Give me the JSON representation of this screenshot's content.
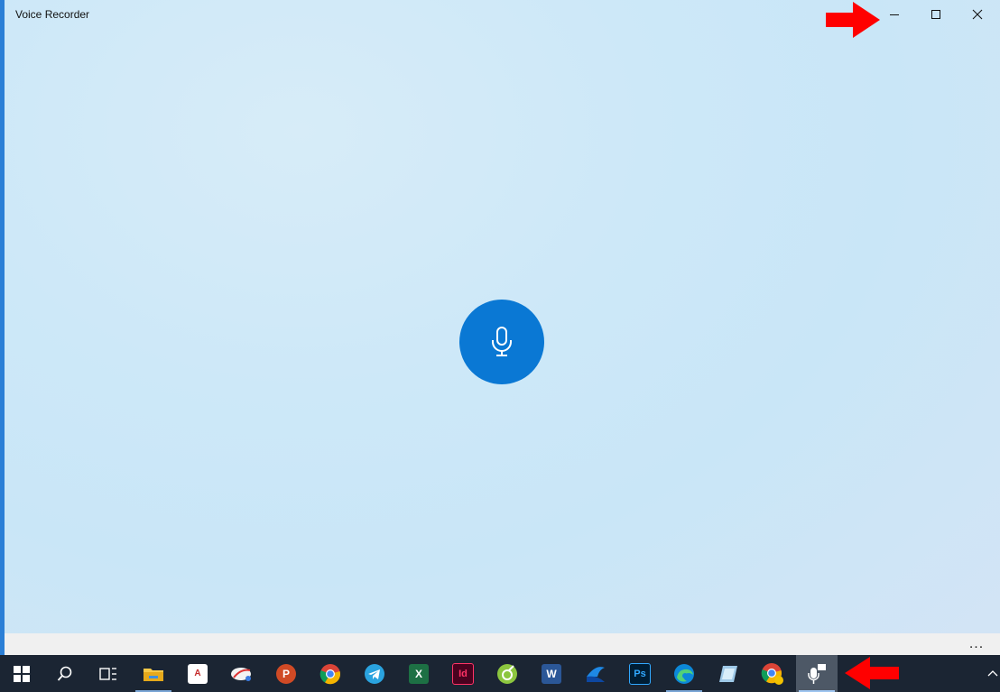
{
  "window": {
    "title": "Voice Recorder"
  },
  "main": {
    "record_button_icon": "microphone-icon"
  },
  "bottom_bar": {
    "more_label": "..."
  },
  "taskbar": {
    "apps": [
      {
        "name": "start",
        "icon": "windows-logo-icon"
      },
      {
        "name": "search",
        "icon": "search-icon"
      },
      {
        "name": "task-view",
        "icon": "task-view-icon"
      },
      {
        "name": "file-explorer",
        "icon": "folder-icon"
      },
      {
        "name": "app-5",
        "icon": "app-icon"
      },
      {
        "name": "app-6",
        "icon": "app-icon"
      },
      {
        "name": "powerpoint",
        "icon": "powerpoint-icon",
        "letter": "P"
      },
      {
        "name": "chrome",
        "icon": "chrome-icon"
      },
      {
        "name": "telegram",
        "icon": "telegram-icon"
      },
      {
        "name": "excel",
        "icon": "excel-icon",
        "letter": "X"
      },
      {
        "name": "indesign",
        "icon": "indesign-icon",
        "letter": "Id"
      },
      {
        "name": "app-12",
        "icon": "app-icon"
      },
      {
        "name": "word",
        "icon": "word-icon",
        "letter": "W"
      },
      {
        "name": "app-14",
        "icon": "app-icon"
      },
      {
        "name": "photoshop",
        "icon": "photoshop-icon",
        "letter": "Ps"
      },
      {
        "name": "edge",
        "icon": "edge-icon"
      },
      {
        "name": "app-17",
        "icon": "app-icon"
      },
      {
        "name": "chrome-canary",
        "icon": "chrome-icon"
      },
      {
        "name": "voice-recorder",
        "icon": "voice-recorder-icon"
      }
    ]
  },
  "colors": {
    "accent": "#0a78d4",
    "annotation_arrow": "#ff0000",
    "taskbar": "#1b2533"
  }
}
